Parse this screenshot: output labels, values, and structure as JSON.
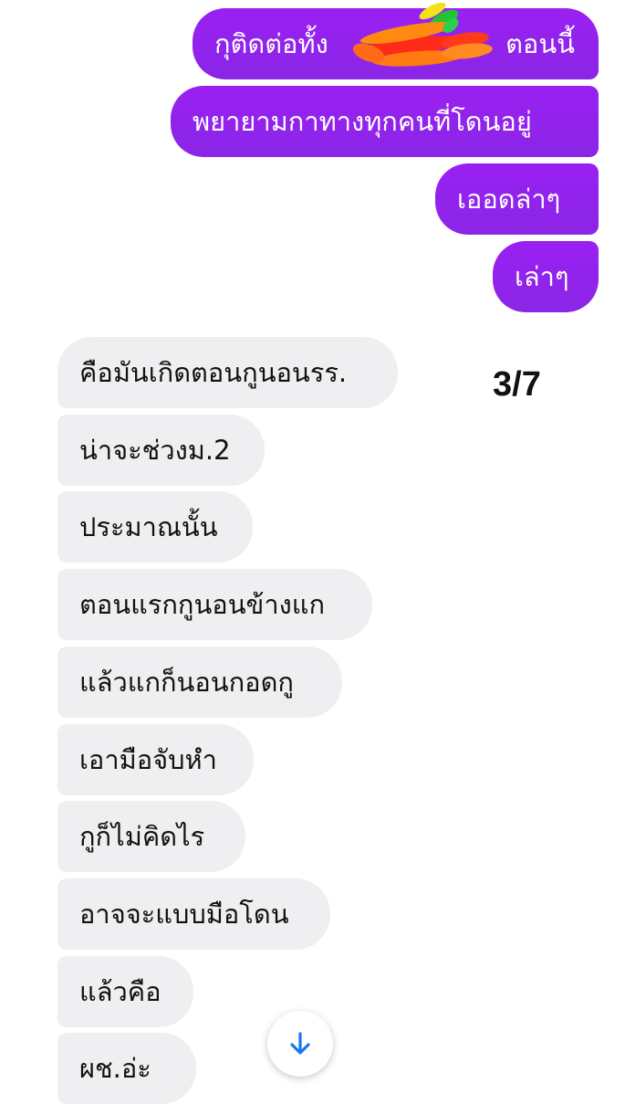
{
  "conversation": {
    "outgoing": [
      {
        "text": "กุติดต่อทั้ง",
        "text_after_redaction": "ตอนนี้"
      },
      {
        "text": "พยายามกาทางทุกคนที่โดนอยู่"
      },
      {
        "text": "เออดล่าๆ"
      },
      {
        "text": "เล่าๆ"
      }
    ],
    "incoming": [
      {
        "text": "คือมันเกิดตอนกูนอนรร."
      },
      {
        "text": "น่าจะช่วงม.2"
      },
      {
        "text": "ประมาณนั้น"
      },
      {
        "text": "ตอนแรกกูนอนข้างแก"
      },
      {
        "text": "แล้วแกก็นอนกอดกู"
      },
      {
        "text": "เอามือจับหำ"
      },
      {
        "text": "กูก็ไม่คิดไร"
      },
      {
        "text": "อาจจะแบบมือโดน"
      },
      {
        "text": "แล้วคือ"
      },
      {
        "text": "ผช.อ่ะ"
      }
    ]
  },
  "overlay": {
    "page_counter": "3/7"
  },
  "controls": {
    "scroll_down_icon": "arrow-down-icon"
  },
  "colors": {
    "outgoing_bubble": "#8a26e6",
    "incoming_bubble": "#efeff1",
    "scroll_arrow": "#1877f2"
  }
}
